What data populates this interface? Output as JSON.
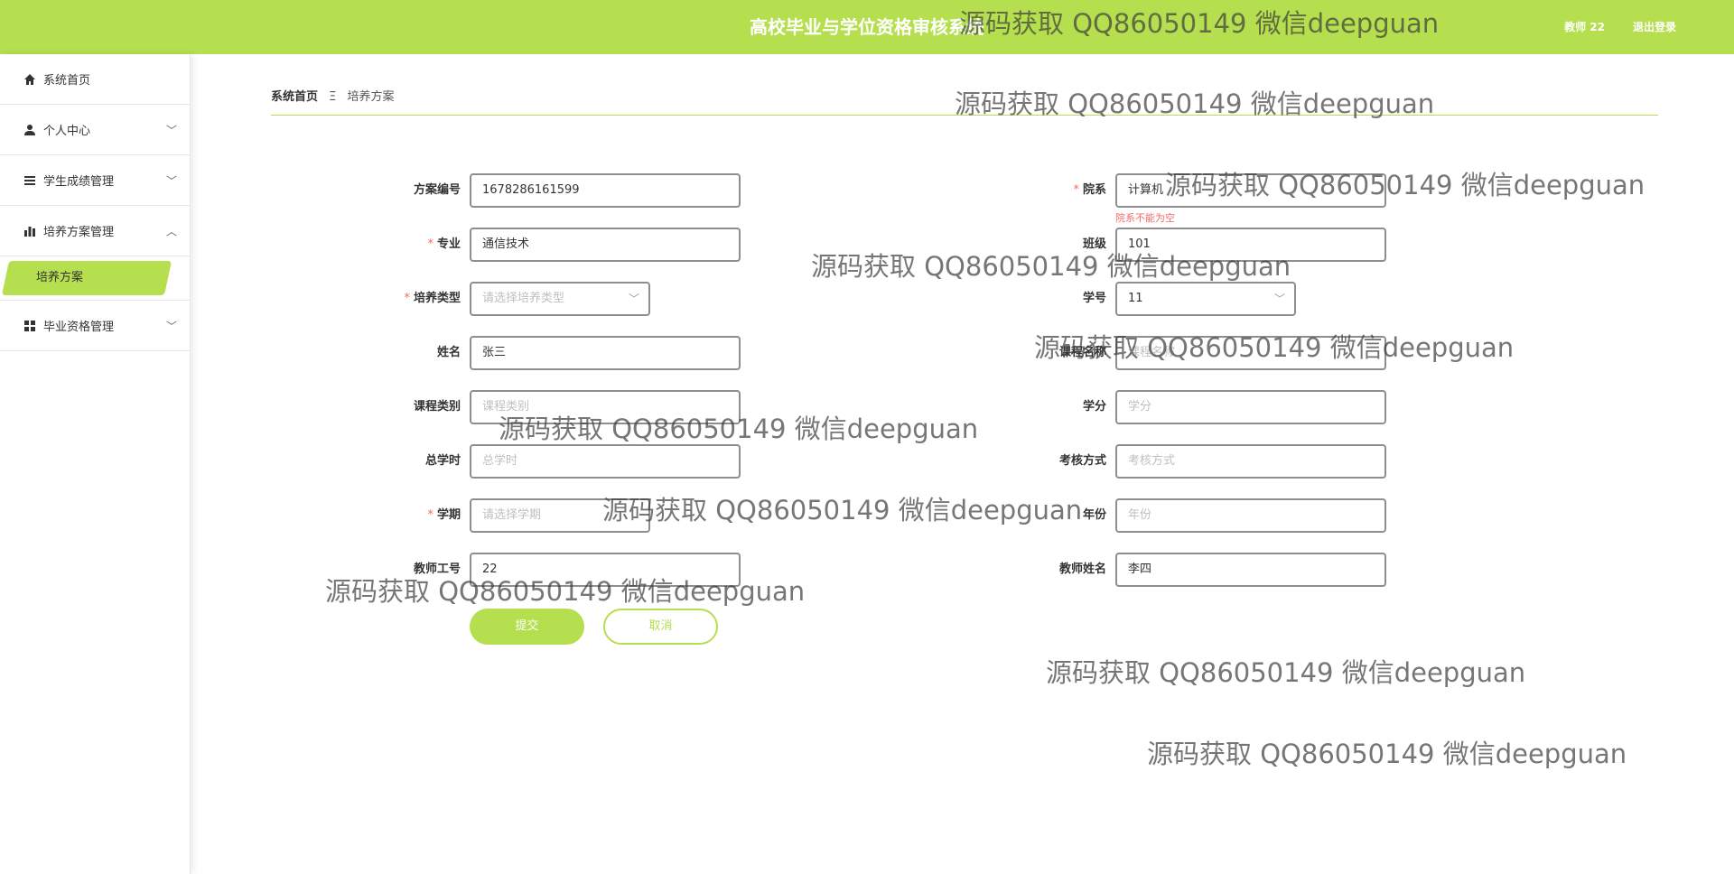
{
  "header": {
    "title": "高校毕业与学位资格审核系统",
    "user": "教师 22",
    "logout": "退出登录"
  },
  "sidebar": {
    "items": [
      {
        "label": "系统首页",
        "icon": "home-icon"
      },
      {
        "label": "个人中心",
        "icon": "user-icon"
      },
      {
        "label": "学生成绩管理",
        "icon": "list-icon"
      },
      {
        "label": "培养方案管理",
        "icon": "bar-chart-icon"
      },
      {
        "label": "毕业资格管理",
        "icon": "grid-icon"
      }
    ],
    "active_sub": "培养方案",
    "accent": "#b5df4e"
  },
  "breadcrumb": {
    "home": "系统首页",
    "separator": "Ξ",
    "current": "培养方案"
  },
  "form": {
    "fields": [
      {
        "label": "方案编号",
        "value": "1678286161599",
        "required": false
      },
      {
        "label": "院系",
        "value": "计算机",
        "required": true,
        "error": "院系不能为空"
      },
      {
        "label": "专业",
        "value": "通信技术",
        "required": true
      },
      {
        "label": "班级",
        "value": "101",
        "required": false
      },
      {
        "label": "培养类型",
        "placeholder": "请选择培养类型",
        "required": true
      },
      {
        "label": "学号",
        "value": "11",
        "required": false
      },
      {
        "label": "姓名",
        "value": "张三",
        "required": false
      },
      {
        "label": "课程名称",
        "placeholder": "课程名称",
        "required": false
      },
      {
        "label": "课程类别",
        "placeholder": "课程类别",
        "required": false
      },
      {
        "label": "学分",
        "placeholder": "学分",
        "required": false
      },
      {
        "label": "总学时",
        "placeholder": "总学时",
        "required": false
      },
      {
        "label": "考核方式",
        "placeholder": "考核方式",
        "required": false
      },
      {
        "label": "学期",
        "placeholder": "请选择学期",
        "required": true
      },
      {
        "label": "年份",
        "placeholder": "年份",
        "required": false
      },
      {
        "label": "教师工号",
        "value": "22",
        "required": false
      },
      {
        "label": "教师姓名",
        "value": "李四",
        "required": false
      }
    ],
    "submit": "提交",
    "cancel": "取消"
  },
  "watermark": "源码获取 QQ86050149 微信deepguan"
}
